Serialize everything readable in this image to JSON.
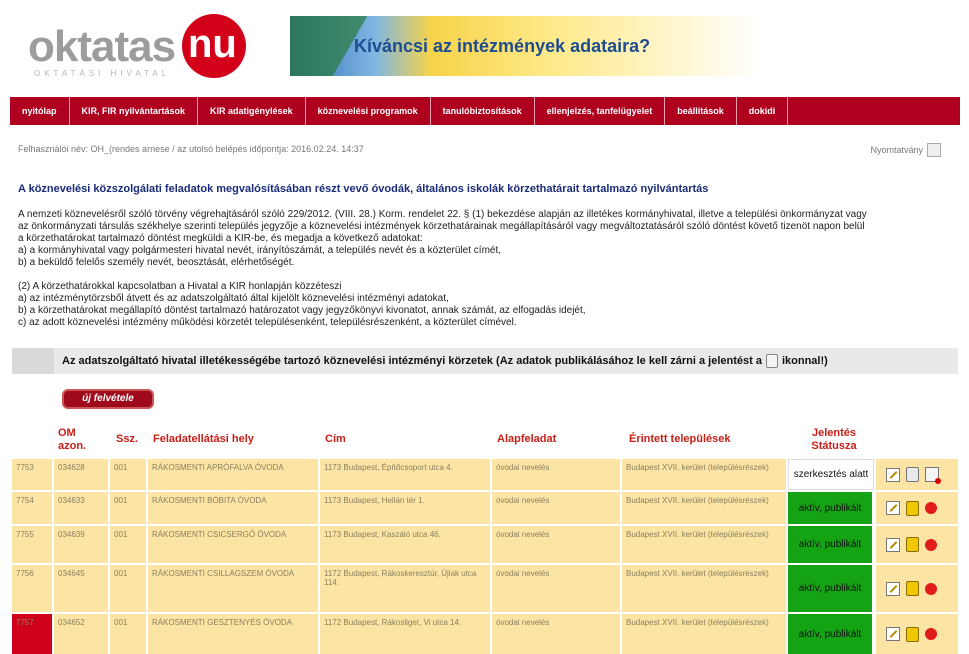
{
  "logo": {
    "word": "oktatas",
    "suffix": "nu",
    "subtitle": "OKTATÁSI HIVATAL"
  },
  "banner": {
    "text": "Kíváncsi az intézmények adataira?"
  },
  "nav": {
    "items": [
      "nyitólap",
      "KIR, FIR nyilvántartások",
      "KIR adatigénylések",
      "köznevelési programok",
      "tanulóbiztosítások",
      "ellenjelzés, tanfelügyelet",
      "beállítások",
      "dokidi"
    ]
  },
  "breadcrumb": "Felhasználói név: OH_(rendes arnese / az utolsó belépés időpontja: 2016.02.24. 14:37",
  "print_label": "Nyomtatvány",
  "title": "A köznevelési közszolgálati feladatok megvalósításában részt vevő óvodák, általános iskolák körzethatárait tartalmazó nyilvántartás",
  "paragraph1": [
    "A nemzeti köznevelésről szóló törvény végrehajtásáról szóló 229/2012. (VIII. 28.) Korm. rendelet 22. § (1) bekezdése alapján az illetékes kormányhivatal, illetve a települési önkormányzat vagy",
    "az önkormányzati társulás székhelye szerinti település jegyzője a köznevelési intézmények körzethatárainak megállapításáról vagy megváltoztatásáról szóló döntést követő tizenöt napon belül",
    "a körzethatárokat tartalmazó döntést megküldi a KIR-be, és megadja a következő adatokat:",
    "a) a kormányhivatal vagy polgármesteri hivatal nevét, irányítószámát, a település nevét és a közterület címét,",
    "b) a beküldő felelős személy nevét, beosztását, elérhetőségét."
  ],
  "paragraph2": [
    "(2) A körzethatárokkal kapcsolatban a Hivatal a KIR honlapján közzéteszi",
    "a) az intézménytörzsből átvett és az adatszolgáltató által kijelölt köznevelési intézményi adatokat,",
    "b) a körzethatárokat megállapító döntést tartalmazó határozatot vagy jegyzőkönyvi kivonatot, annak számát, az elfogadás idejét,",
    "c) az adott köznevelési intézmény működési körzetét településenként, településrészenként, a közterület címével."
  ],
  "section": {
    "text_before": "Az adatszolgáltató hivatal illetékességébe tartozó köznevelési intézményi körzetek (Az adatok publikálásához le kell zárni a jelentést a",
    "text_after": "ikonnal!)"
  },
  "new_button": "új felvétele",
  "table": {
    "headers": {
      "om": "OM azon.",
      "ssz": "Ssz.",
      "place": "Feladatellátási hely",
      "address": "Cím",
      "task": "Alapfeladat",
      "settlements": "Érintett települések",
      "status": "Jelentés Státusza"
    },
    "rows": [
      {
        "id": "7753",
        "om": "034628",
        "ssz": "001",
        "place": "RÁKOSMENTI APRÓFALVA ÓVODA",
        "address": "1173 Budapest, Építőcsoport utca 4.",
        "task": "óvodai nevelés",
        "settlements": "Budapest XVII. kerület (településrészek)",
        "status": "szerkesztés alatt",
        "status_color": "#ffffff"
      },
      {
        "id": "7754",
        "om": "034633",
        "ssz": "001",
        "place": "RÁKOSMENTI BÓBITA ÓVODA",
        "address": "1173 Budapest, Hellán tér 1.",
        "task": "óvodai nevelés",
        "settlements": "Budapest XVII. kerület (településrészek)",
        "status": "aktív, publikált",
        "status_color": "#14a313"
      },
      {
        "id": "7755",
        "om": "034639",
        "ssz": "001",
        "place": "RÁKOSMENTI CSICSERGŐ ÓVODA",
        "address": "1173 Budapest, Kaszáló utca 46.",
        "task": "óvodai nevelés",
        "settlements": "Budapest XVII. kerület (településrészek)",
        "status": "aktív, publikált",
        "status_color": "#14a313"
      },
      {
        "id": "7756",
        "om": "034645",
        "ssz": "001",
        "place": "RÁKOSMENTI CSILLAGSZEM ÓVODA",
        "address": "1172 Budapest, Rákoskeresztúr, Újlak utca 114.",
        "task": "óvodai nevelés",
        "settlements": "Budapest XVII. kerület (településrészek)",
        "status": "aktív, publikált",
        "status_color": "#14a313"
      },
      {
        "id": "7757",
        "om": "034652",
        "ssz": "001",
        "place": "RÁKOSMENTI GESZTENYÉS ÓVODA",
        "address": "1172 Budapest, Rákosliget, Vi utca 14.",
        "task": "óvodai nevelés",
        "settlements": "Budapest XVII. kerület (településrészek)",
        "status": "aktív, publikált",
        "status_color": "#14a313"
      }
    ]
  }
}
